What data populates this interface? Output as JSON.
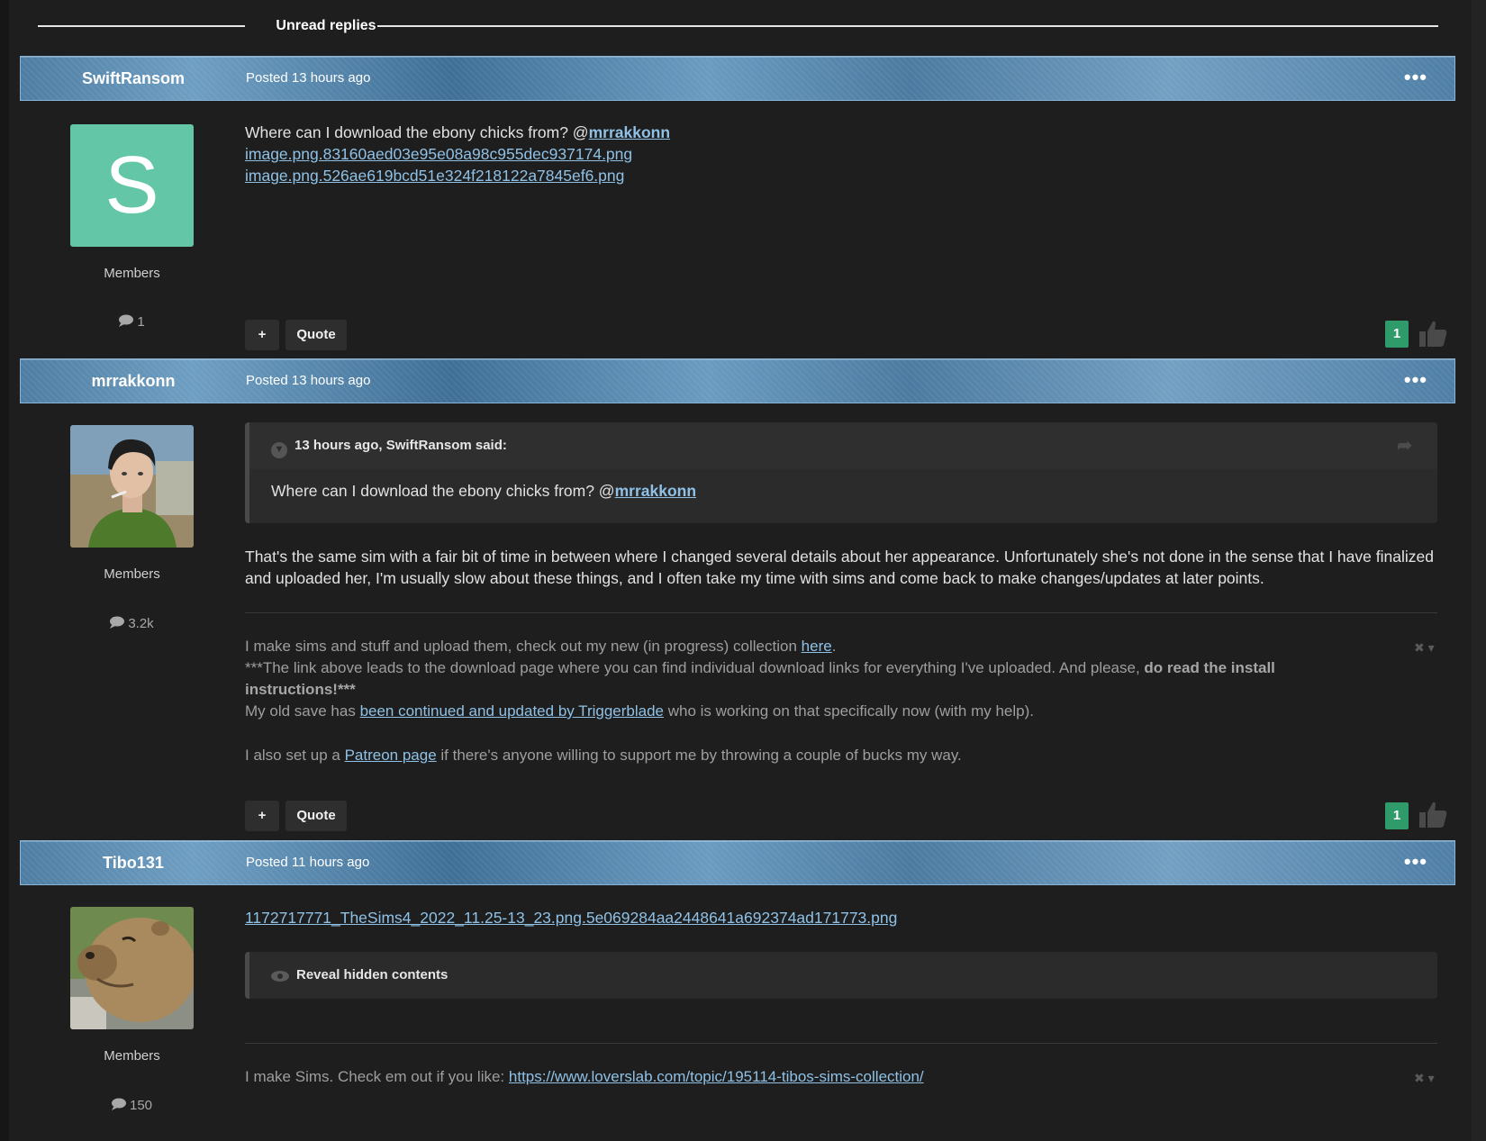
{
  "divider": {
    "label": "Unread replies"
  },
  "posts": [
    {
      "author": "SwiftRansom",
      "posted": "Posted 13 hours ago",
      "avatar_letter": "S",
      "avatar_color": "#63c6a6",
      "group": "Members",
      "post_count": "1",
      "body": {
        "text": "Where can I download the ebony chicks from? @",
        "mention": "mrrakkonn",
        "images": [
          "image.png.83160aed03e95e08a98c955dec937174.png",
          "image.png.526ae619bcd51e324f218122a7845ef6.png"
        ]
      },
      "reputation": "1"
    },
    {
      "author": "mrrakkonn",
      "posted": "Posted 13 hours ago",
      "group": "Members",
      "post_count": "3.2k",
      "quote": {
        "header": "13 hours ago, SwiftRansom said:",
        "text": "Where can I download the ebony chicks from? @",
        "mention": "mrrakkonn"
      },
      "body": "That's the same sim with a fair bit of time in between where I changed several details about her appearance. Unfortunately she's not done in the sense that I have finalized and uploaded her, I'm usually slow about these things, and I often take my time with sims and come back to make changes/updates at later points.",
      "signature": {
        "line1_pre": "I make sims and stuff and upload them, check out my new (in progress) collection ",
        "line1_link": "here",
        "line1_post": ".",
        "line2_pre": "***The link above leads to the download page where you can find individual download links for everything I've uploaded. And please, ",
        "line2_bold": "do read the install instructions!***",
        "line3_pre": "My old save has ",
        "line3_link": "been continued and updated by Triggerblade",
        "line3_post": " who is working on that specifically now (with my help).",
        "line4_pre": "I also set up a ",
        "line4_link": "Patreon page",
        "line4_post": " if there's anyone willing to support me by throwing a couple of bucks my way."
      },
      "reputation": "1"
    },
    {
      "author": "Tibo131",
      "posted": "Posted 11 hours ago",
      "group": "Members",
      "post_count": "150",
      "image_link": "1172717771_TheSims4_2022_11.25-13_23.png.5e069284aa2448641a692374ad171773.png",
      "reveal": "Reveal hidden contents",
      "signature": {
        "pre": "I make Sims. Check em out if you like: ",
        "link": "https://www.loverslab.com/topic/195114-tibos-sims-collection/"
      }
    }
  ],
  "buttons": {
    "plus": "+",
    "quote": "Quote"
  },
  "icons": {
    "more": "ellipsis-icon",
    "comment": "comment-bubble-icon",
    "thumb": "thumbs-up-icon",
    "chevron": "chevron-down-icon",
    "share": "share-icon",
    "eye": "eye-icon",
    "signature_x": "close-icon"
  }
}
